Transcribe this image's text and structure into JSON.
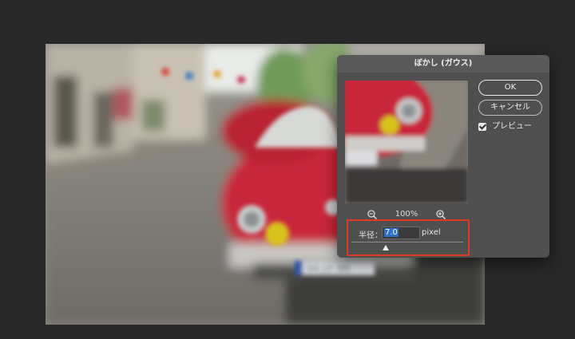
{
  "dialog": {
    "title": "ぼかし (ガウス)",
    "ok_label": "OK",
    "cancel_label": "キャンセル",
    "preview_label": "プレビュー",
    "preview_checked": true,
    "zoom_level": "100%",
    "radius": {
      "label": "半径：",
      "value": "7.0",
      "unit": "pixel",
      "slider_position": 0.31
    }
  },
  "colors": {
    "app_background": "#282828",
    "dialog_background": "#4f4f4f",
    "highlight_box": "#e03a22",
    "selection": "#2e6ec9"
  },
  "canvas": {
    "plate_text": "34 LY 98"
  }
}
